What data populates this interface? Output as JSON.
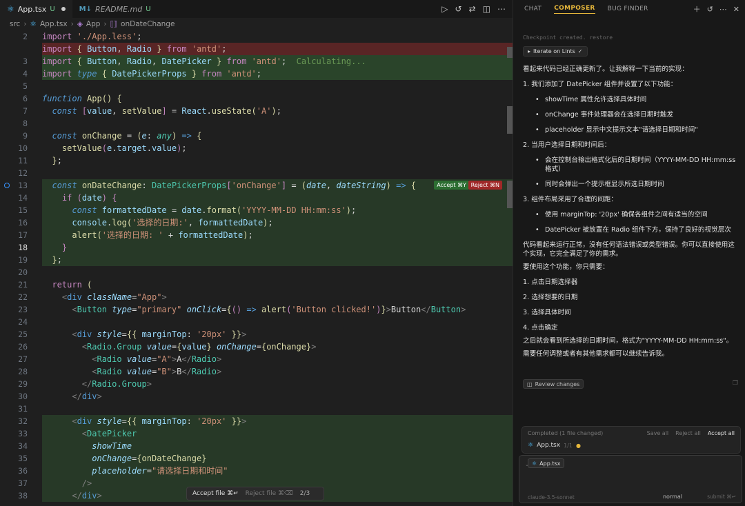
{
  "editor": {
    "tabs": [
      {
        "name": "App.tsx",
        "status": "U"
      },
      {
        "name": "README.md",
        "status": "U"
      }
    ],
    "breadcrumb": [
      "src",
      "App.tsx",
      "App",
      "onDateChange"
    ],
    "calculating": "Calculating...",
    "accept_inline": "Accept ⌘Y",
    "reject_inline": "Reject ⌘N",
    "bottom_bar": {
      "accept": "Accept file ⌘↵",
      "reject": "Reject file ⌘⌫",
      "count": "2/3"
    },
    "line_numbers": [
      "2",
      "3",
      "4",
      "5",
      "6",
      "7",
      "8",
      "9",
      "10",
      "11",
      "12",
      "13",
      "14",
      "15",
      "16",
      "17",
      "18",
      "19",
      "20",
      "21",
      "22",
      "23",
      "24",
      "25",
      "26",
      "27",
      "28",
      "29",
      "30",
      "31",
      "32",
      "33",
      "34",
      "35",
      "36",
      "37",
      "38"
    ]
  },
  "composer": {
    "tabs": [
      "CHAT",
      "COMPOSER",
      "BUG FINDER"
    ],
    "checkpoint": "Checkpoint created. restore",
    "iterate_label": "Iterate on Lints",
    "intro": "看起来代码已经正确更新了。让我解释一下当前的实现：",
    "section1": "1. 我们添加了 DatePicker 组件并设置了以下功能：",
    "section1_items": [
      "showTime 属性允许选择具体时间",
      "onChange 事件处理器会在选择日期时触发",
      "placeholder 显示中文提示文本\"请选择日期和时间\""
    ],
    "section2": "2. 当用户选择日期和时间后：",
    "section2_items": [
      "会在控制台输出格式化后的日期时间（YYYY-MM-DD HH:mm:ss格式）",
      "同时会弹出一个提示框显示所选日期时间"
    ],
    "section3": "3. 组件布局采用了合理的间距：",
    "section3_items": [
      "使用 marginTop: '20px' 确保各组件之间有适当的空间",
      "DatePicker 被放置在 Radio 组件下方，保持了良好的视觉层次"
    ],
    "summary": "代码看起来运行正常，没有任何语法错误或类型错误。你可以直接使用这个实现，它完全满足了你的需求。",
    "usage_intro": "要使用这个功能，你只需要：",
    "steps": [
      "1. 点击日期选择器",
      "2. 选择想要的日期",
      "3. 选择具体时间",
      "4. 点击确定"
    ],
    "result": "之后就会看到所选择的日期时间，格式为\"YYYY-MM-DD HH:mm:ss\"。",
    "closing": "需要任何调整或者有其他需求都可以继续告诉我。",
    "review_btn": "Review changes",
    "completed": {
      "header": "Completed (1 file changed)",
      "save_all": "Save all",
      "reject_all": "Reject all",
      "accept_all": "Accept all",
      "file": "App.tsx",
      "count": "1/1"
    },
    "input": {
      "chip": "App.tsx",
      "model": "claude-3.5-sonnet",
      "mode": "normal",
      "submit": "submit ⌘↵"
    }
  }
}
